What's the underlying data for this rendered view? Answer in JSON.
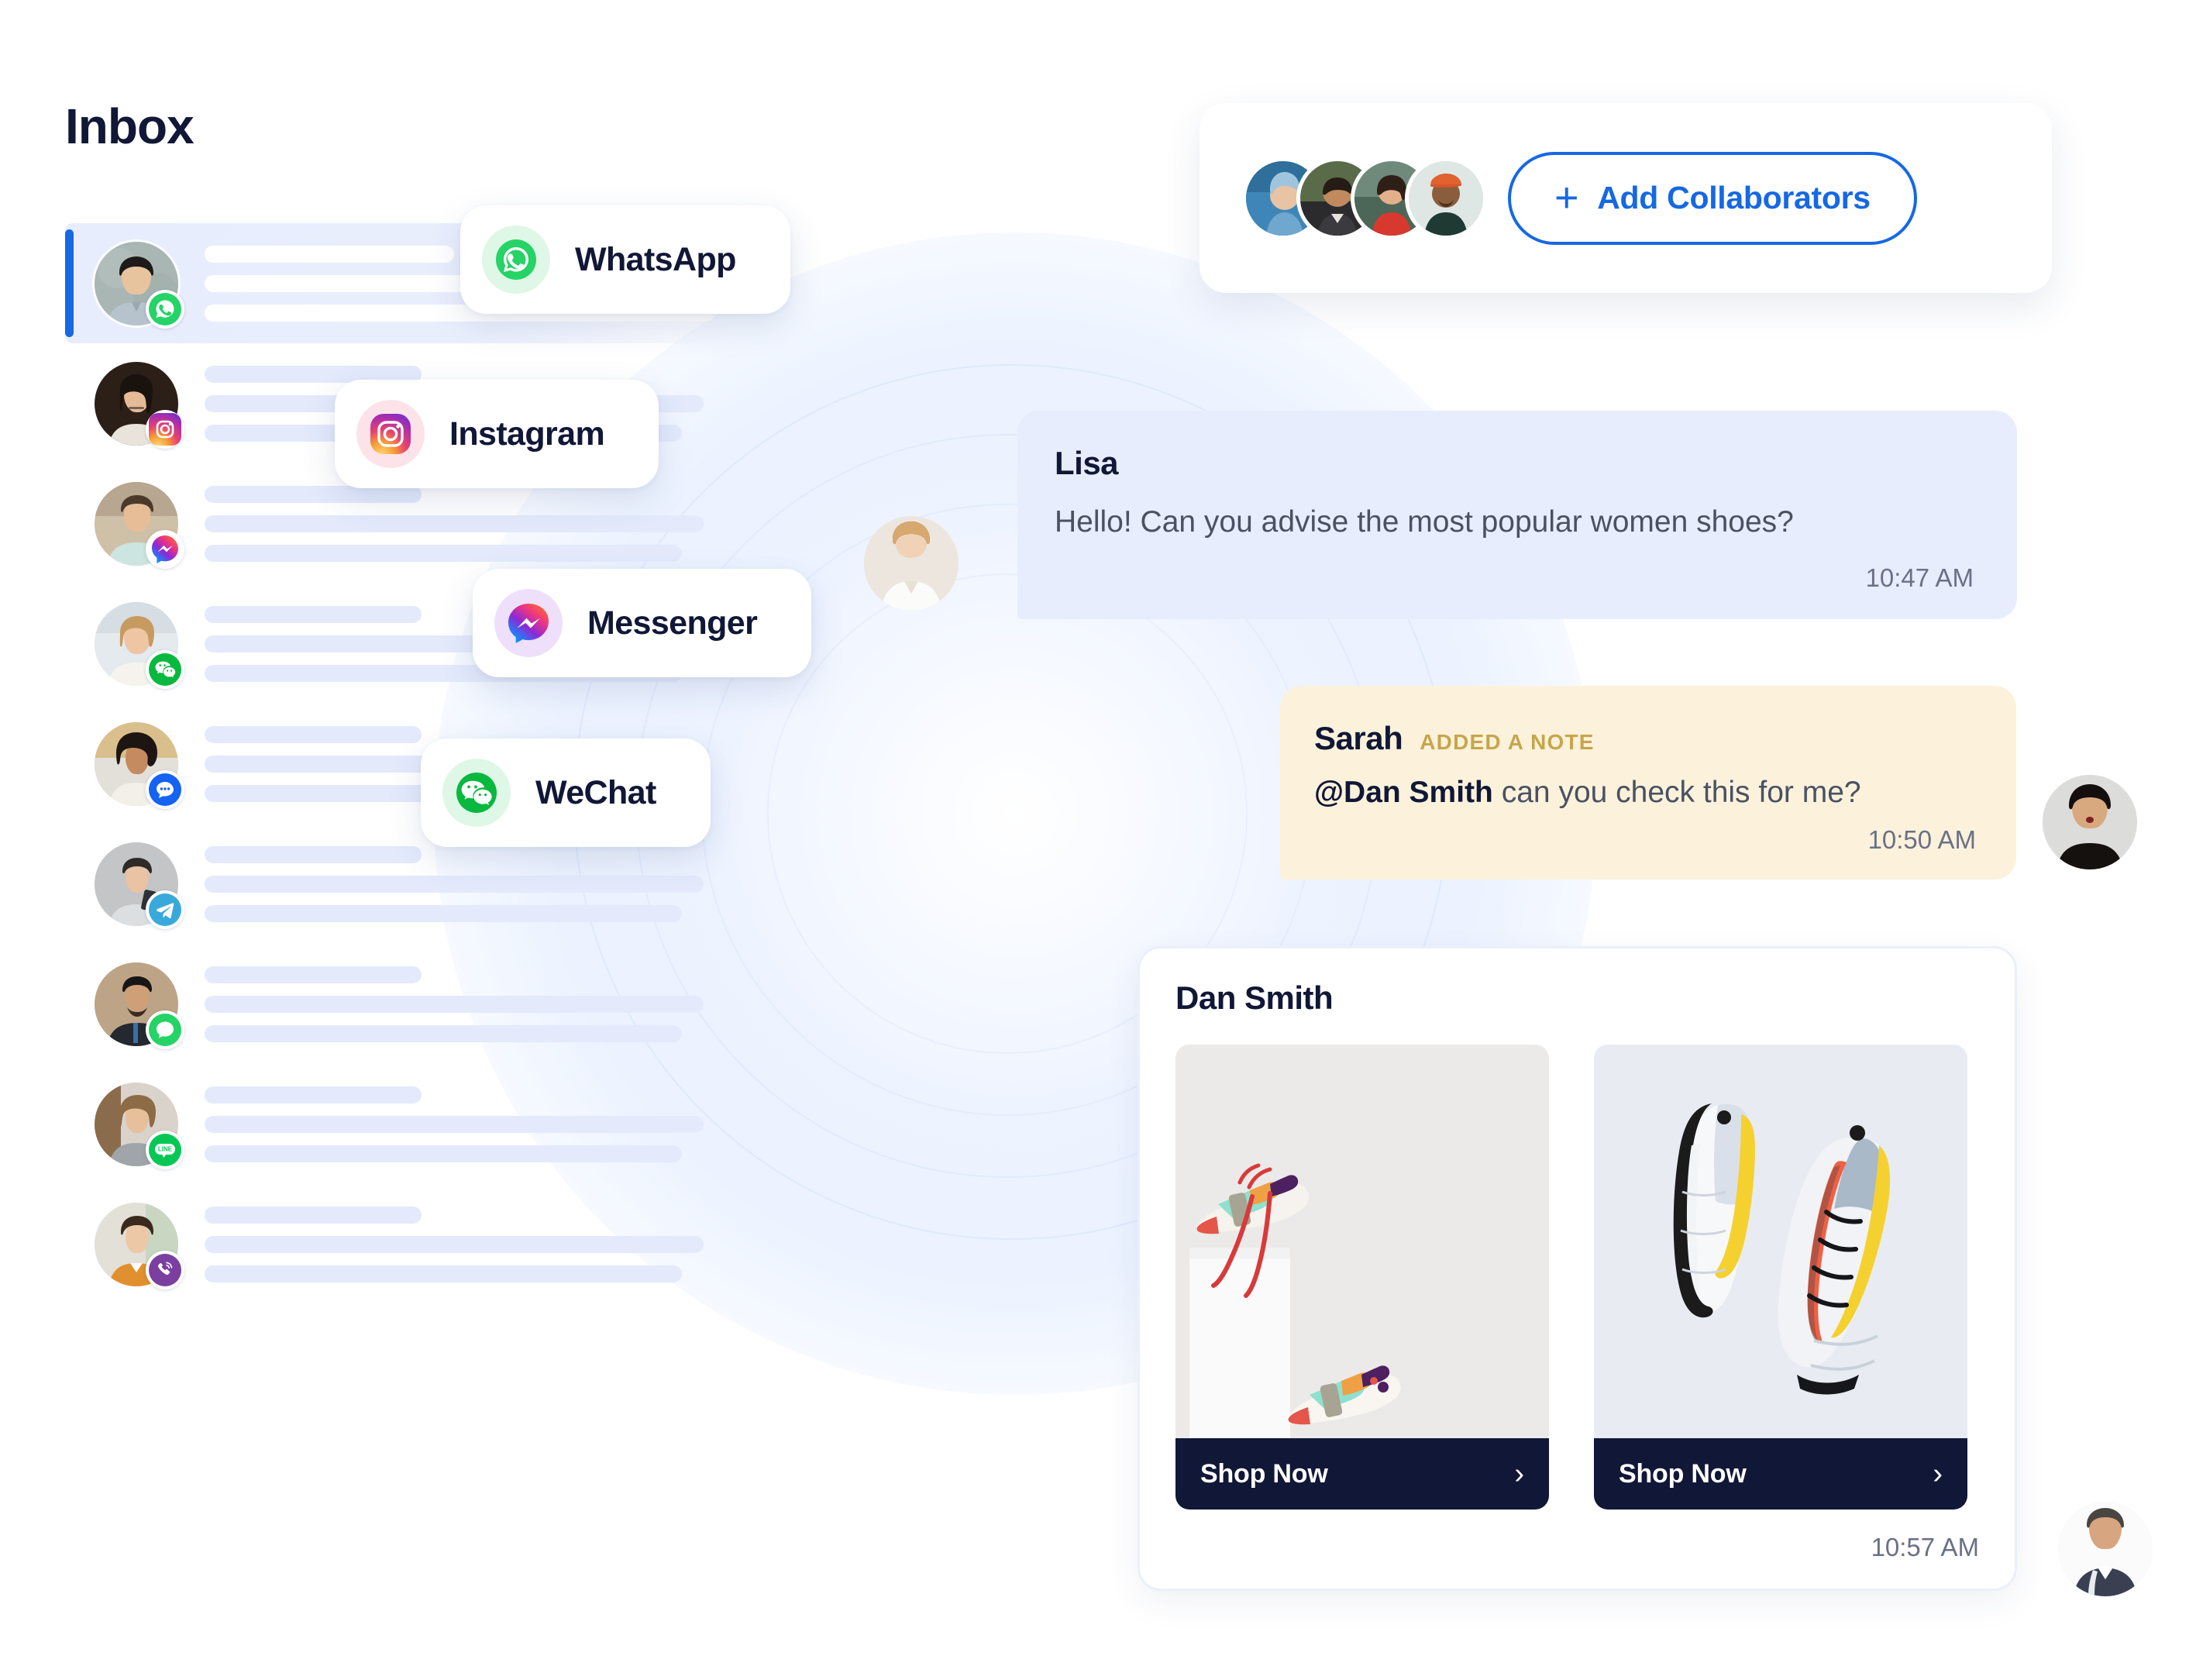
{
  "page": {
    "title": "Inbox"
  },
  "channels": [
    {
      "name": "WhatsApp",
      "icon": "whatsapp-icon",
      "color": "#25D366",
      "bg": "#dff7e6"
    },
    {
      "name": "Instagram",
      "icon": "instagram-icon",
      "color": "#E1306C",
      "bg": "#fbe3e9"
    },
    {
      "name": "Messenger",
      "icon": "messenger-icon",
      "color": "#A033FF",
      "bg": "#eee0fb"
    },
    {
      "name": "WeChat",
      "icon": "wechat-icon",
      "color": "#09B83E",
      "bg": "#dff7e6"
    }
  ],
  "inbox": {
    "rows": [
      {
        "channel": "WhatsApp",
        "icon": "whatsapp-badge-icon",
        "selected": true,
        "avatar_tone": "#9fb0ae"
      },
      {
        "channel": "Instagram",
        "icon": "instagram-badge-icon",
        "selected": false,
        "avatar_tone": "#3b2a26"
      },
      {
        "channel": "Messenger",
        "icon": "messenger-badge-icon",
        "selected": false,
        "avatar_tone": "#c9bfae"
      },
      {
        "channel": "WeChat",
        "icon": "wechat-badge-icon",
        "selected": false,
        "avatar_tone": "#cfd6db"
      },
      {
        "channel": "SMS",
        "icon": "sms-badge-icon",
        "selected": false,
        "avatar_tone": "#d9c9a8"
      },
      {
        "channel": "Telegram",
        "icon": "telegram-badge-icon",
        "selected": false,
        "avatar_tone": "#bdbdbd"
      },
      {
        "channel": "WhatsApp",
        "icon": "whatsapp2-badge-icon",
        "selected": false,
        "avatar_tone": "#b4a08a"
      },
      {
        "channel": "LINE",
        "icon": "line-badge-icon",
        "selected": false,
        "avatar_tone": "#c3a98e"
      },
      {
        "channel": "Viber",
        "icon": "viber-badge-icon",
        "selected": false,
        "avatar_tone": "#cfc4ae"
      }
    ]
  },
  "collaborators": {
    "avatars": [
      "collaborator-1",
      "collaborator-2",
      "collaborator-3",
      "collaborator-4"
    ],
    "add_label": "Add Collaborators",
    "plus_glyph": "+",
    "accent_color": "#1668e3"
  },
  "conversation": {
    "lisa": {
      "name": "Lisa",
      "text": "Hello! Can you advise the most popular women shoes?",
      "time": "10:47 AM"
    },
    "note": {
      "name": "Sarah",
      "tag": "ADDED A NOTE",
      "mention": "@Dan Smith",
      "text": " can you check this for me?",
      "time": "10:50 AM"
    },
    "dan": {
      "name": "Dan Smith",
      "time": "10:57 AM",
      "products": [
        {
          "label": "Shop Now",
          "chevron": "›",
          "alt": "colorful-sneakers-on-box"
        },
        {
          "label": "Shop Now",
          "chevron": "›",
          "alt": "grey-yellow-running-shoes"
        }
      ]
    }
  }
}
